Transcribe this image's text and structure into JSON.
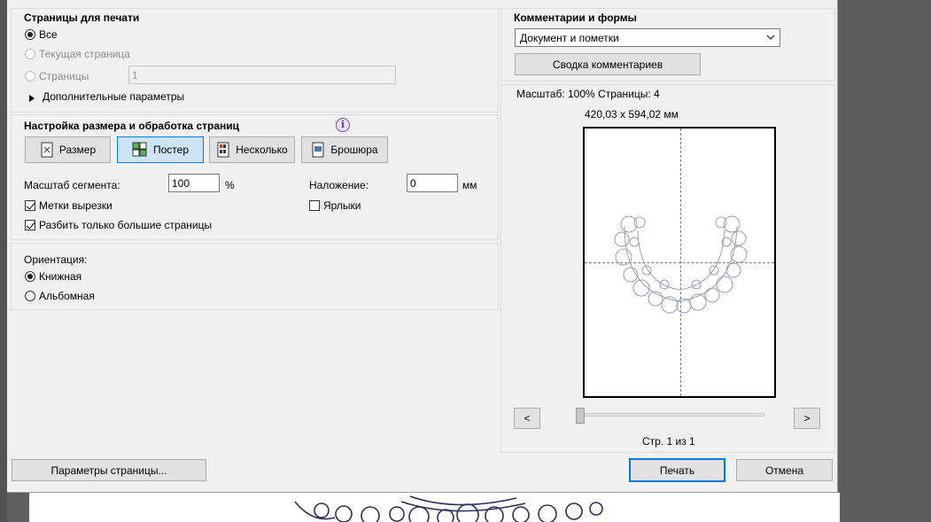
{
  "pages_section": {
    "title": "Страницы для печати",
    "opt_all": "Все",
    "opt_current": "Текущая страница",
    "opt_pages": "Страницы",
    "pages_value": "1",
    "more_options": "Дополнительные параметры"
  },
  "sizing_section": {
    "title": "Настройка размера и обработка страниц",
    "btn_size": "Размер",
    "btn_poster": "Постер",
    "btn_multiple": "Несколько",
    "btn_booklet": "Брошюра",
    "tile_scale_label": "Масштаб сегмента:",
    "tile_scale_value": "100",
    "tile_scale_unit": "%",
    "overlap_label": "Наложение:",
    "overlap_value": "0",
    "overlap_unit": "мм",
    "cut_marks": "Метки вырезки",
    "labels": "Ярлыки",
    "tile_large_only": "Разбить только большие страницы"
  },
  "orientation_section": {
    "title": "Ориентация:",
    "portrait": "Книжная",
    "landscape": "Альбомная"
  },
  "comments_section": {
    "title": "Комментарии и формы",
    "select_value": "Документ и пометки",
    "summary_button": "Сводка комментариев"
  },
  "preview": {
    "scale_info": "Масштаб: 100% Страницы: 4",
    "dimensions": "420,03 x 594,02 мм",
    "prev": "<",
    "next": ">",
    "page_label": "Стр. 1 из 1"
  },
  "footer": {
    "page_setup": "Параметры страницы...",
    "print": "Печать",
    "cancel": "Отмена"
  },
  "colors": {
    "accent": "#0078d7",
    "dialog_bg": "#f0f0f0",
    "active_button_bg": "#cce4f7"
  }
}
